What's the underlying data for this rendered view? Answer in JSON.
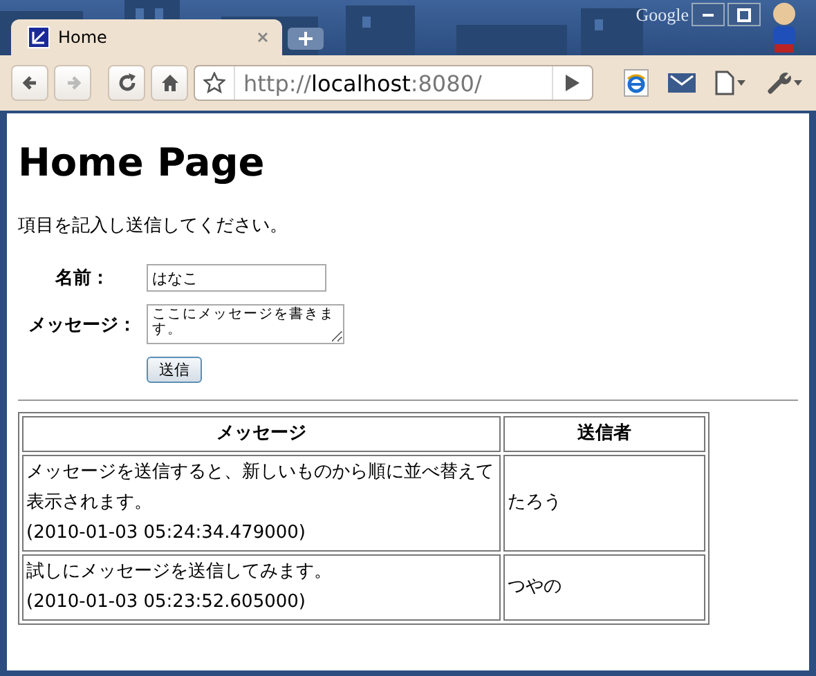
{
  "window": {
    "brand": "Google",
    "tabs": [
      {
        "title": "Home",
        "selected": true
      }
    ],
    "nav": [
      {
        "kind": "back",
        "disabled": false
      },
      {
        "kind": "forward",
        "disabled": true
      },
      {
        "kind": "reload",
        "disabled": false
      },
      {
        "kind": "home",
        "disabled": false
      }
    ],
    "address": {
      "scheme": "http://",
      "host": "localhost",
      "port": ":8080/"
    }
  },
  "page": {
    "heading": "Home Page",
    "intro": "項目を記入し送信してください。",
    "form": {
      "fields": [
        {
          "kind": "input",
          "label": "名前：",
          "value": "はなこ"
        },
        {
          "kind": "textarea",
          "label": "メッセージ：",
          "value": "ここにメッセージを書きます。"
        }
      ],
      "submit": "送信"
    },
    "table": {
      "columns": [
        "メッセージ",
        "送信者"
      ],
      "rows": [
        {
          "message": "メッセージを送信すると、新しいものから順に並べ替えて表示されます。",
          "timestamp": "(2010-01-03 05:24:34.479000)",
          "sender": "たろう"
        },
        {
          "message": "試しにメッセージを送信してみます。",
          "timestamp": "(2010-01-03 05:23:52.605000)",
          "sender": "つやの"
        }
      ]
    }
  }
}
